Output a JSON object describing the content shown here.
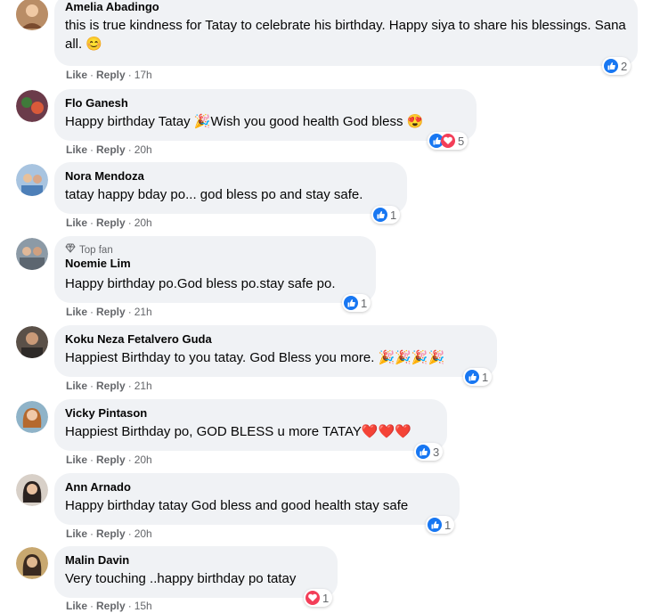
{
  "comments": [
    {
      "name": "Amelia Abadingo",
      "text": "this is true kindness for Tatay to celebrate his birthday. Happy siya to share his blessings. Sana all. 😊",
      "time": "17h",
      "count": "2"
    },
    {
      "name": "Flo Ganesh",
      "text": "Happy birthday Tatay 🎉Wish you good health God bless 😍",
      "time": "20h",
      "count": "5"
    },
    {
      "name": "Nora Mendoza",
      "text": "tatay happy bday po... god bless po and stay safe.",
      "time": "20h",
      "count": "1"
    },
    {
      "name": "Noemie Lim",
      "badge": "Top fan",
      "text": "Happy birthday po.God bless po.stay safe po.",
      "time": "21h",
      "count": "1"
    },
    {
      "name": "Koku Neza Fetalvero Guda",
      "text": "Happiest Birthday to you tatay. God Bless you more. 🎉🎉🎉🎉",
      "time": "21h",
      "count": "1"
    },
    {
      "name": "Vicky Pintason",
      "text": "Happiest Birthday po, GOD BLESS u more TATAY❤️❤️❤️",
      "time": "20h",
      "count": "3"
    },
    {
      "name": "Ann Arnado",
      "text": "Happy birthday tatay God bless and good health stay safe",
      "time": "20h",
      "count": "1"
    },
    {
      "name": "Malin Davin",
      "text": "Very touching ..happy birthday po tatay",
      "time": "15h",
      "count": "1"
    }
  ],
  "actions": {
    "like": "Like",
    "reply": "Reply",
    "separator": "·"
  },
  "colors": {
    "like": "#1877f2",
    "love": "#f33e58",
    "bubble": "#f0f2f5",
    "meta": "#65676b"
  },
  "icons": {
    "like": "thumbs-up-icon",
    "love": "heart-icon",
    "top_fan": "diamond-icon"
  }
}
